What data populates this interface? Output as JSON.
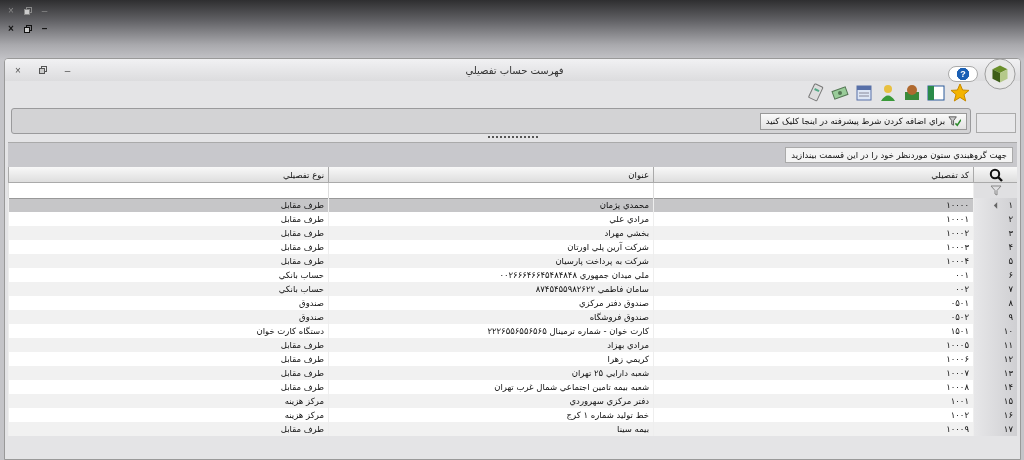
{
  "outer_window": {
    "buttons": [
      "–",
      "×"
    ]
  },
  "inner_window_buttons": [
    "–",
    "×"
  ],
  "window": {
    "title": "فهرست حساب تفصيلي",
    "help": "?",
    "buttons": [
      "–",
      "×"
    ]
  },
  "filter_bar": {
    "button": "براي اضافه کردن شرط پيشرفته در اينجا کليک کنيد"
  },
  "group_panel": {
    "hint": "جهت گروهبندي ستون موردنظر خود را در اين قسمت بيندازيد"
  },
  "table": {
    "columns": [
      "کد تفصيلي",
      "عنوان",
      "نوع تفصيلي"
    ],
    "rows": [
      {
        "number": "۱",
        "code": "۱۰۰۰۰",
        "title": "محمدي پژمان",
        "type": "طرف مقابل",
        "selected": true
      },
      {
        "number": "۲",
        "code": "۱۰۰۰۱",
        "title": "مرادي علي",
        "type": "طرف مقابل",
        "selected": false
      },
      {
        "number": "۳",
        "code": "۱۰۰۰۲",
        "title": "بخشي مهراد",
        "type": "طرف مقابل",
        "selected": false
      },
      {
        "number": "۴",
        "code": "۱۰۰۰۳",
        "title": "شرکت آرين پلي اورتان",
        "type": "طرف مقابل",
        "selected": false
      },
      {
        "number": "۵",
        "code": "۱۰۰۰۴",
        "title": "شرکت به پرداخت پارسيان",
        "type": "طرف مقابل",
        "selected": false
      },
      {
        "number": "۶",
        "code": "۰۰۱",
        "title": "ملي ميدان جمهوري ۰۰۲۶۶۶۴۶۶۴۵۴۸۴۸۴۸",
        "type": "حساب بانکي",
        "selected": false
      },
      {
        "number": "۷",
        "code": "۰۰۲",
        "title": "سامان فاطمي ۸۷۴۵۴۵۵۹۸۲۶۲۲",
        "type": "حساب بانکي",
        "selected": false
      },
      {
        "number": "۸",
        "code": "۰۵۰۱",
        "title": "صندوق دفتر مرکزي",
        "type": "صندوق",
        "selected": false
      },
      {
        "number": "۹",
        "code": "۰۵۰۲",
        "title": "صندوق فروشگاه",
        "type": "صندوق",
        "selected": false
      },
      {
        "number": "۱۰",
        "code": "۱۵۰۱",
        "title": "کارت خوان - شماره ترمينال ۲۲۲۶۵۵۶۵۵۶۵۶۵",
        "type": "دستگاه کارت خوان",
        "selected": false
      },
      {
        "number": "۱۱",
        "code": "۱۰۰۰۵",
        "title": "مرادي بهزاد",
        "type": "طرف مقابل",
        "selected": false
      },
      {
        "number": "۱۲",
        "code": "۱۰۰۰۶",
        "title": "کريمي زهرا",
        "type": "طرف مقابل",
        "selected": false
      },
      {
        "number": "۱۳",
        "code": "۱۰۰۰۷",
        "title": "شعبه دارايي ۲۵ تهران",
        "type": "طرف مقابل",
        "selected": false
      },
      {
        "number": "۱۴",
        "code": "۱۰۰۰۸",
        "title": "شعبه بيمه تامين اجتماعي شمال غرب تهران",
        "type": "طرف مقابل",
        "selected": false
      },
      {
        "number": "۱۵",
        "code": "۱۰۰۱",
        "title": "دفتر مرکزي سهروردي",
        "type": "مرکز هزينه",
        "selected": false
      },
      {
        "number": "۱۶",
        "code": "۱۰۰۲",
        "title": "خط توليد شماره ۱ کرج",
        "type": "مرکز هزينه",
        "selected": false
      },
      {
        "number": "۱۷",
        "code": "۱۰۰۰۹",
        "title": "بيمه سينا",
        "type": "طرف مقابل",
        "selected": false
      }
    ]
  }
}
